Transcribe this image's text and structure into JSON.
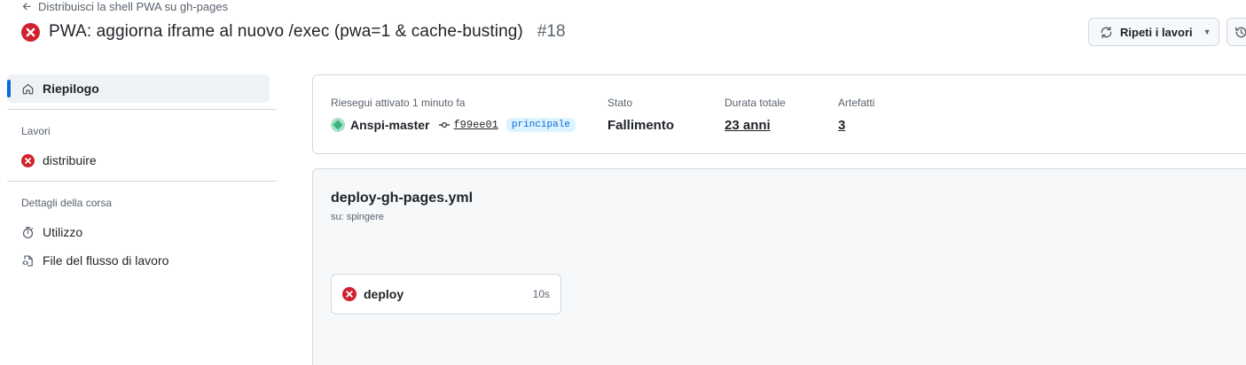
{
  "header": {
    "back_label": "Distribuisci la shell PWA su gh-pages",
    "title": "PWA: aggiorna iframe al nuovo /exec (pwa=1 & cache-busting)",
    "run_number": "#18",
    "rerun_label": "Ripeti i lavori",
    "status_color": "#cf222e"
  },
  "sidebar": {
    "summary_label": "Riepilogo",
    "jobs_heading": "Lavori",
    "jobs": [
      {
        "label": "distribuire",
        "status": "failure"
      }
    ],
    "details_heading": "Dettagli della corsa",
    "details": [
      {
        "label": "Utilizzo",
        "icon": "stopwatch-icon"
      },
      {
        "label": "File del flusso di lavoro",
        "icon": "file-code-icon"
      }
    ]
  },
  "summary": {
    "trigger_label": "Riesegui attivato 1 minuto fa",
    "actor": "Anspi-master",
    "commit": "f99ee01",
    "branch": "principale",
    "status_label": "Stato",
    "status_value": "Fallimento",
    "duration_label": "Durata totale",
    "duration_value": "23 anni",
    "artifacts_label": "Artefatti",
    "artifacts_value": "3"
  },
  "workflow": {
    "file": "deploy-gh-pages.yml",
    "trigger": "su: spingere",
    "job": {
      "name": "deploy",
      "duration": "10s",
      "status": "failure"
    }
  },
  "colors": {
    "accent": "#0969da",
    "failure": "#cf222e",
    "branch_bg": "#ddf4ff"
  }
}
